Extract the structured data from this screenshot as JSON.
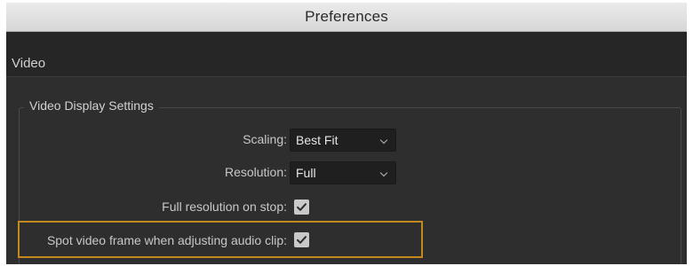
{
  "window": {
    "title": "Preferences"
  },
  "section": {
    "label": "Video"
  },
  "group": {
    "title": "Video Display Settings"
  },
  "settings": {
    "scaling": {
      "label": "Scaling:",
      "value": "Best Fit"
    },
    "resolution": {
      "label": "Resolution:",
      "value": "Full"
    },
    "full_resolution_on_stop": {
      "label": "Full resolution on stop:",
      "checked": true
    },
    "spot_video_frame": {
      "label": "Spot video frame when adjusting audio clip:",
      "checked": true
    }
  },
  "colors": {
    "panel_background": "#2e2e2e",
    "highlight_border": "#c08a1e"
  },
  "icons": {
    "dropdown": "chevron-down-icon",
    "checkbox": "checkmark-icon"
  }
}
